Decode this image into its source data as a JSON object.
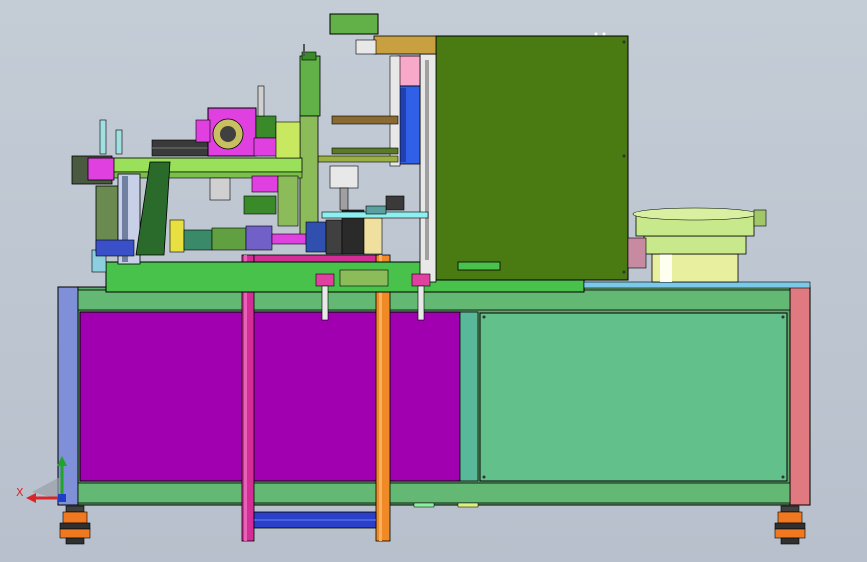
{
  "viewport": {
    "background_top": "#c4ccd6",
    "background_bottom": "#b7c0cc"
  },
  "triad": {
    "x_label": "X",
    "x_color": "#d8262a",
    "y_color": "#1fa62a",
    "z_color": "#1c3ec8"
  },
  "palette": {
    "cabinet_left_panel": "#a000b0",
    "cabinet_right_panel": "#62c08a",
    "cabinet_frame": "#62a86c",
    "cabinet_left_post": "#7f8fd8",
    "cabinet_right_post": "#e07a80",
    "table_top": "#49c24c",
    "enclosure": "#4a7a12",
    "magenta_leg": "#d42e96",
    "orange_leg": "#f08a26",
    "blue_crossbar": "#2a40c8",
    "bowl_feeder": "#c8e88c",
    "linear_rail": "#8cf0f0",
    "hopper": "#62b048",
    "robot_block": "#e040e0",
    "caster_orange": "#f07820"
  }
}
